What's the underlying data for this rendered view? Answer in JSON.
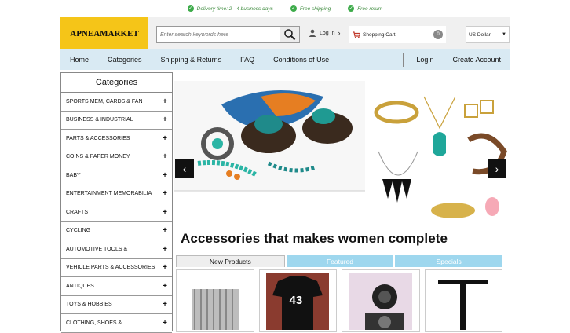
{
  "topbar": {
    "delivery": "Delivery time: 2 - 4 business days",
    "shipping": "Free shipping",
    "return": "Free return"
  },
  "header": {
    "logo": "APNEAMARKET",
    "search_placeholder": "Enter search keywords here",
    "login": "Log In",
    "cart_label": "Shopping Cart",
    "cart_count": "0",
    "currency": "US Dollar"
  },
  "nav": {
    "home": "Home",
    "categories": "Categories",
    "shipping_returns": "Shipping & Returns",
    "faq": "FAQ",
    "conditions": "Conditions of Use",
    "login": "Login",
    "create_account": "Create Account"
  },
  "sidebar": {
    "title": "Categories",
    "items": [
      "SPORTS MEM, CARDS & FAN",
      "BUSINESS & INDUSTRIAL",
      "PARTS & ACCESSORIES",
      "COINS & PAPER MONEY",
      "BABY",
      "ENTERTAINMENT MEMORABILIA",
      "CRAFTS",
      "CYCLING",
      "AUTOMOTIVE TOOLS &",
      "VEHICLE PARTS & ACCESSORIES",
      "ANTIQUES",
      "TOYS & HOBBIES",
      "CLOTHING, SHOES &"
    ]
  },
  "banner": {
    "caption": "Accessories that makes women complete"
  },
  "tabs": {
    "new": "New Products",
    "featured": "Featured",
    "specials": "Specials"
  },
  "products": {
    "jersey_number": "43"
  },
  "colors": {
    "accent": "#f5c518",
    "nav_bg": "#d9eaf3",
    "tab_bg": "#9ed7ee",
    "check": "#3dab4a"
  }
}
